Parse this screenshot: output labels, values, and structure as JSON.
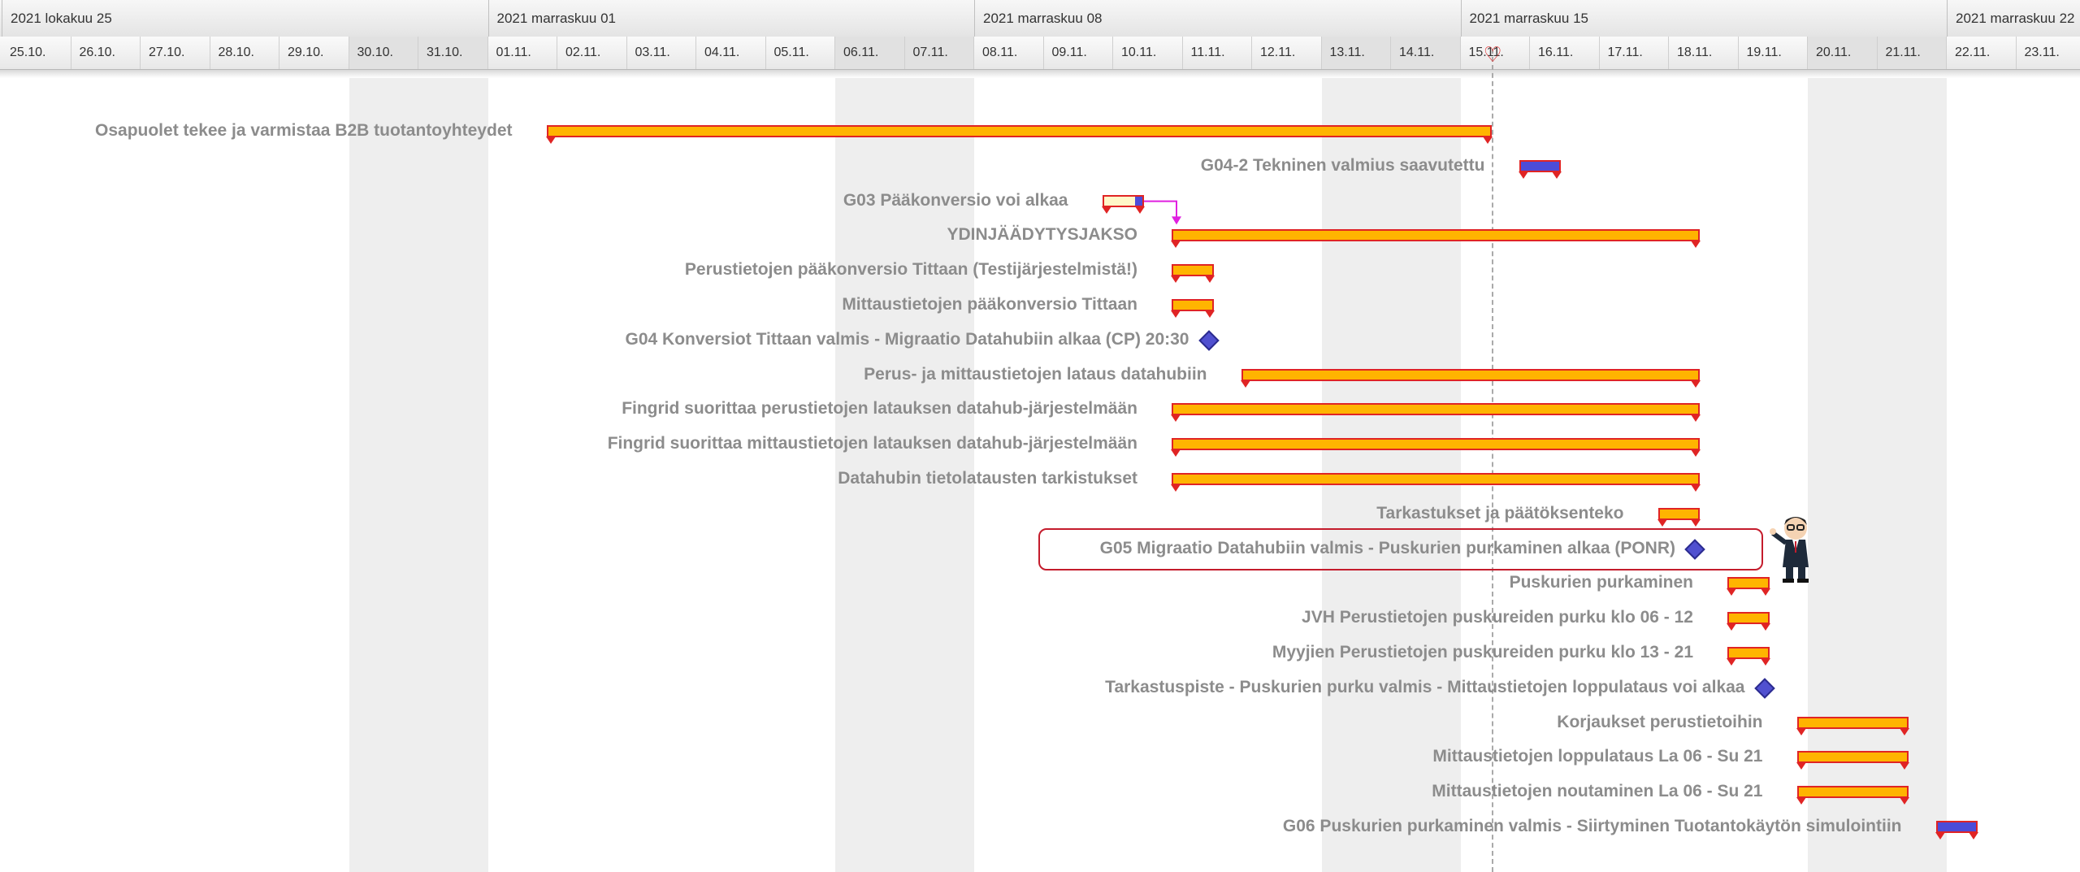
{
  "timeline": {
    "weeks": [
      {
        "label": "2021 lokakuu 25"
      },
      {
        "label": "2021 marraskuu 01"
      },
      {
        "label": "2021 marraskuu 08"
      },
      {
        "label": "2021 marraskuu 15"
      },
      {
        "label": "2021 marraskuu 22"
      }
    ],
    "days": [
      "25.10.",
      "26.10.",
      "27.10.",
      "28.10.",
      "29.10.",
      "30.10.",
      "31.10.",
      "01.11.",
      "02.11.",
      "03.11.",
      "04.11.",
      "05.11.",
      "06.11.",
      "07.11.",
      "08.11.",
      "09.11.",
      "10.11.",
      "11.11.",
      "12.11.",
      "13.11.",
      "14.11.",
      "15.11.",
      "16.11.",
      "17.11.",
      "18.11.",
      "19.11.",
      "20.11.",
      "21.11.",
      "22.11.",
      "23.11."
    ],
    "weekend_days": [
      "30.10.",
      "31.10.",
      "06.11.",
      "07.11.",
      "13.11.",
      "14.11.",
      "20.11.",
      "21.11."
    ],
    "today": "15.11."
  },
  "tasks": [
    {
      "id": "t1",
      "label": "Osapuolet tekee ja varmistaa B2B tuotantoyhteydet",
      "start": "01.11.",
      "end": "15.11.",
      "type": "summary"
    },
    {
      "id": "t2",
      "label": "G04-2 Tekninen valmius saavutettu",
      "start": "15.11.",
      "end": "16.11.",
      "type": "blue"
    },
    {
      "id": "t3",
      "label": "G03 Pääkonversio voi alkaa",
      "start": "09.11.",
      "end": "10.11.",
      "type": "cream",
      "progress": 0.2
    },
    {
      "id": "t4",
      "label": "YDINJÄÄDYTYSJAKSO",
      "start": "10.11.",
      "end": "18.11.",
      "type": "summary"
    },
    {
      "id": "t5",
      "label": "Perustietojen pääkonversio Tittaan (Testijärjestelmistä!)",
      "start": "10.11.",
      "end": "11.11.",
      "type": "summary"
    },
    {
      "id": "t6",
      "label": "Mittaustietojen pääkonversio Tittaan",
      "start": "10.11.",
      "end": "11.11.",
      "type": "summary"
    },
    {
      "id": "t7",
      "label": "G04 Konversiot Tittaan valmis - Migraatio Datahubiin alkaa (CP) 20:30",
      "at": "11.11.",
      "type": "milestone"
    },
    {
      "id": "t8",
      "label": "Perus- ja mittaustietojen lataus datahubiin",
      "start": "11.11.",
      "end": "18.11.",
      "type": "summary"
    },
    {
      "id": "t9",
      "label": "Fingrid suorittaa perustietojen latauksen datahub-järjestelmään",
      "start": "10.11.",
      "end": "18.11.",
      "type": "summary"
    },
    {
      "id": "t10",
      "label": "Fingrid suorittaa mittaustietojen latauksen datahub-järjestelmään",
      "start": "10.11.",
      "end": "18.11.",
      "type": "summary"
    },
    {
      "id": "t11",
      "label": "Datahubin tietolatausten tarkistukset",
      "start": "10.11.",
      "end": "18.11.",
      "type": "summary"
    },
    {
      "id": "t12",
      "label": "Tarkastukset ja päätöksenteko",
      "start": "17.11.",
      "end": "18.11.",
      "type": "summary"
    },
    {
      "id": "t13",
      "label": "G05 Migraatio Datahubiin valmis - Puskurien purkaminen alkaa (PONR)",
      "at": "18.11.",
      "type": "milestone",
      "highlight": true
    },
    {
      "id": "t14",
      "label": "Puskurien purkaminen",
      "start": "18.11.",
      "end": "19.11.",
      "type": "summary"
    },
    {
      "id": "t15",
      "label": "JVH Perustietojen puskureiden purku klo 06 - 12",
      "start": "18.11.",
      "end": "19.11.",
      "type": "summary"
    },
    {
      "id": "t16",
      "label": "Myyjien Perustietojen puskureiden purku klo 13 - 21",
      "start": "18.11.",
      "end": "19.11.",
      "type": "summary"
    },
    {
      "id": "t17",
      "label": "Tarkastuspiste - Puskurien purku valmis - Mittaustietojen loppulataus voi alkaa",
      "at": "19.11.",
      "type": "milestone"
    },
    {
      "id": "t18",
      "label": "Korjaukset perustietoihin",
      "start": "19.11.",
      "end": "21.11.",
      "type": "summary"
    },
    {
      "id": "t19",
      "label": "Mittaustietojen loppulataus La 06 - Su 21",
      "start": "19.11.",
      "end": "21.11.",
      "type": "summary"
    },
    {
      "id": "t20",
      "label": "Mittaustietojen noutaminen La 06 - Su 21",
      "start": "19.11.",
      "end": "21.11.",
      "type": "summary"
    },
    {
      "id": "t21",
      "label": "G06 Puskurien purkaminen valmis - Siirtyminen Tuotantokäytön simulointiin",
      "start": "21.11.",
      "end": "22.11.",
      "type": "blue"
    }
  ],
  "colors": {
    "task": "#ffb400",
    "task_border": "#e02424",
    "milestone": "#5050d0",
    "link": "#e020e0",
    "callout": "#c41c2c"
  }
}
